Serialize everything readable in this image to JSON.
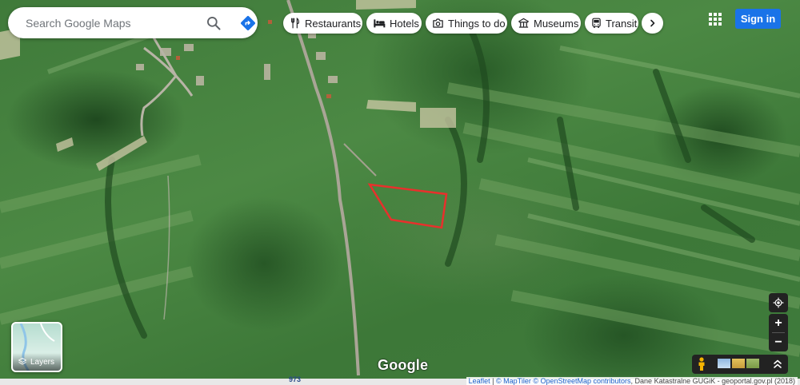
{
  "search": {
    "placeholder": "Search Google Maps"
  },
  "chips": [
    {
      "label": "Restaurants",
      "icon": "fork-knife-icon"
    },
    {
      "label": "Hotels",
      "icon": "bed-icon"
    },
    {
      "label": "Things to do",
      "icon": "camera-icon"
    },
    {
      "label": "Museums",
      "icon": "museum-icon"
    },
    {
      "label": "Transit",
      "icon": "bus-icon"
    }
  ],
  "header": {
    "signin_label": "Sign in"
  },
  "layers": {
    "label": "Layers"
  },
  "map": {
    "logo": "Google",
    "road_number": "973",
    "parcel_outline_color": "#e8302c"
  },
  "attribution": {
    "leaflet": "Leaflet",
    "maptiler": "© MapTiler",
    "osm": "© OpenStreetMap contributors",
    "cadastre": ", Dane Katastralne GUGiK - geoportal.gov.pl (2018)"
  },
  "colors": {
    "accent": "#1a73e8",
    "control_dark": "#222222"
  }
}
